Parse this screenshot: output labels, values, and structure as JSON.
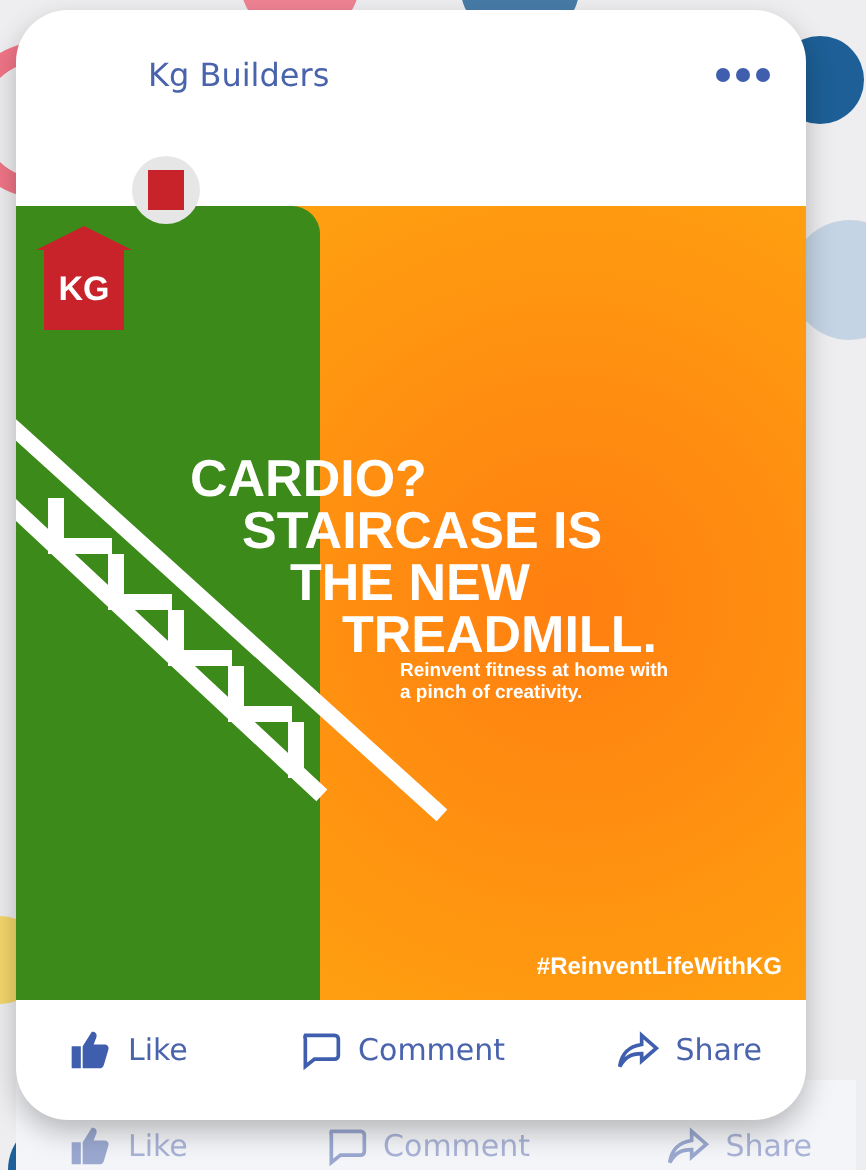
{
  "post": {
    "author": "Kg Builders",
    "image": {
      "logo": "KG",
      "headline": [
        "CARDIO?",
        "STAIRCASE IS",
        "THE NEW",
        "TREADMILL."
      ],
      "tagline": "Reinvent fitness at home with a pinch of creativity.",
      "hashtag": "#ReinventLifeWithKG"
    },
    "actions": [
      {
        "kind": "like",
        "label": "Like"
      },
      {
        "kind": "comment",
        "label": "Comment"
      },
      {
        "kind": "share",
        "label": "Share"
      }
    ]
  },
  "next_post": {
    "actions": [
      {
        "kind": "like",
        "label": "Like"
      },
      {
        "kind": "comment",
        "label": "Comment"
      },
      {
        "kind": "share",
        "label": "Share"
      }
    ]
  }
}
